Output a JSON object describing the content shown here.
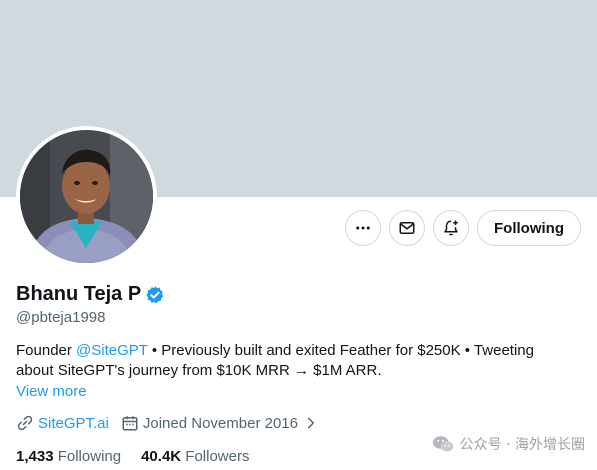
{
  "profile": {
    "name": "Bhanu Teja P",
    "handle": "@pbteja1998",
    "bio_prefix": "Founder ",
    "bio_mention": "@SiteGPT",
    "bio_line1_rest": " • Previously built and exited Feather for $250K • Tweeting",
    "bio_line2": "about SiteGPT's journey from $10K MRR → $1M ARR.",
    "view_more": "View more",
    "website": "SiteGPT.ai",
    "joined": "Joined November 2016",
    "following_count": "1,433",
    "following_label": "Following",
    "followers_count": "40.4K",
    "followers_label": "Followers"
  },
  "actions": {
    "more_icon": "more-horizontal-icon",
    "message_icon": "mail-icon",
    "notify_icon": "bell-plus-icon",
    "follow_label": "Following"
  },
  "watermark": {
    "text": "公众号 · 海外增长圈"
  },
  "colors": {
    "banner": "#cfd9de",
    "link": "#1d9bf0",
    "secondary_text": "#536471",
    "primary_text": "#0f1419",
    "verified": "#1d9bf0"
  }
}
